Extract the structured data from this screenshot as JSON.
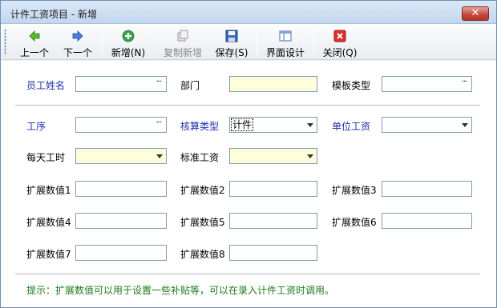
{
  "window": {
    "title": "计件工资项目 - 新增",
    "close_glyph": "✕"
  },
  "toolbar": {
    "prev": "上一个",
    "next": "下一个",
    "new": "新增(N)",
    "copy_new": "复制新增",
    "save": "保存(S)",
    "layout": "界面设计",
    "close": "关闭(Q)"
  },
  "form": {
    "employee_name": {
      "label": "员工姓名",
      "value": ""
    },
    "department": {
      "label": "部门",
      "value": ""
    },
    "template_type": {
      "label": "模板类型",
      "value": ""
    },
    "process": {
      "label": "工序",
      "value": ""
    },
    "calc_type": {
      "label": "核算类型",
      "value": "计件"
    },
    "unit_wage": {
      "label": "单位工资",
      "value": ""
    },
    "daily_hours": {
      "label": "每天工时",
      "value": ""
    },
    "standard_wage": {
      "label": "标准工资",
      "value": ""
    },
    "ext1": {
      "label": "扩展数值1",
      "value": ""
    },
    "ext2": {
      "label": "扩展数值2",
      "value": ""
    },
    "ext3": {
      "label": "扩展数值3",
      "value": ""
    },
    "ext4": {
      "label": "扩展数值4",
      "value": ""
    },
    "ext5": {
      "label": "扩展数值5",
      "value": ""
    },
    "ext6": {
      "label": "扩展数值6",
      "value": ""
    },
    "ext7": {
      "label": "扩展数值7",
      "value": ""
    },
    "ext8": {
      "label": "扩展数值8",
      "value": ""
    },
    "ellipsis": "···"
  },
  "hint": "提示：扩展数值可以用于设置一些补贴等，可以在录入计件工资时调用。",
  "colors": {
    "blue_label": "#1f2fb0",
    "required_bg": "#ffffdc",
    "hint": "#1c7a1c"
  },
  "icons": {
    "prev": "arrow-left-icon",
    "next": "arrow-right-icon",
    "new": "plus-circle-icon",
    "copy_new": "copy-icon",
    "save": "floppy-disk-icon",
    "layout": "layout-icon",
    "close": "close-x-icon"
  }
}
